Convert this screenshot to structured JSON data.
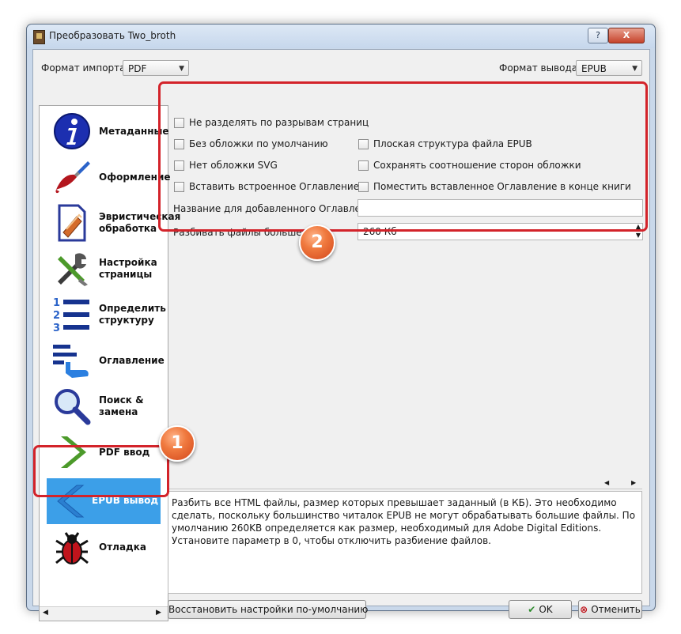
{
  "window": {
    "title": "Преобразовать Two_broth",
    "help": "?",
    "close": "X"
  },
  "header": {
    "import_label": "Формат импорта:",
    "import_value": "PDF",
    "output_label": "Формат вывода:",
    "output_value": "EPUB"
  },
  "sidebar": {
    "items": [
      {
        "label1": "Метаданные",
        "label2": "",
        "icon": "info-icon"
      },
      {
        "label1": "Оформление",
        "label2": "",
        "icon": "paintbrush-icon"
      },
      {
        "label1": "Эвристическая",
        "label2": "обработка",
        "icon": "heuristic-document-icon"
      },
      {
        "label1": "Настройка",
        "label2": "страницы",
        "icon": "tools-icon"
      },
      {
        "label1": "Определить",
        "label2": "структуру",
        "icon": "numbered-list-icon"
      },
      {
        "label1": "Оглавление",
        "label2": "",
        "icon": "toc-pointer-icon"
      },
      {
        "label1": "Поиск &",
        "label2": "замена",
        "icon": "magnifier-icon"
      },
      {
        "label1": "PDF ввод",
        "label2": "",
        "icon": "chevron-right-icon"
      },
      {
        "label1": "EPUB вывод",
        "label2": "",
        "icon": "chevron-left-icon"
      },
      {
        "label1": "Отладка",
        "label2": "",
        "icon": "bug-icon"
      }
    ]
  },
  "options": {
    "no_split_page_breaks": "Не разделять по разрывам страниц",
    "no_default_cover": "Без обложки по умолчанию",
    "flat_epub": "Плоская структура файла EPUB",
    "no_svg_cover": "Нет обложки SVG",
    "preserve_aspect": "Сохранять соотношение сторон обложки",
    "insert_toc": "Вставить встроенное Оглавление",
    "toc_at_end": "Поместить вставленное Оглавление в конце книги",
    "toc_title_label": "Название для добавленного Оглавления:",
    "toc_title_value": "",
    "split_label": "Разбивать файлы больше чем",
    "split_value": "260 Кб"
  },
  "badges": {
    "one": "1",
    "two": "2"
  },
  "description": "Разбить все HTML файлы, размер которых превышает заданный (в КБ). Это необходимо сделать, поскольку большинство читалок EPUB не могут обрабатывать большие файлы. По умолчанию 260KB определяется как размер, необходимый для Adobe Digital Editions. Установите параметр в 0, чтобы отключить разбиение файлов.",
  "buttons": {
    "restore": "Восстановить настройки по-умолчанию",
    "ok": "OK",
    "cancel": "Отменить"
  },
  "colors": {
    "selected": "#3c9fe8",
    "highlight": "#d3232a",
    "badge": "#e8622e"
  }
}
